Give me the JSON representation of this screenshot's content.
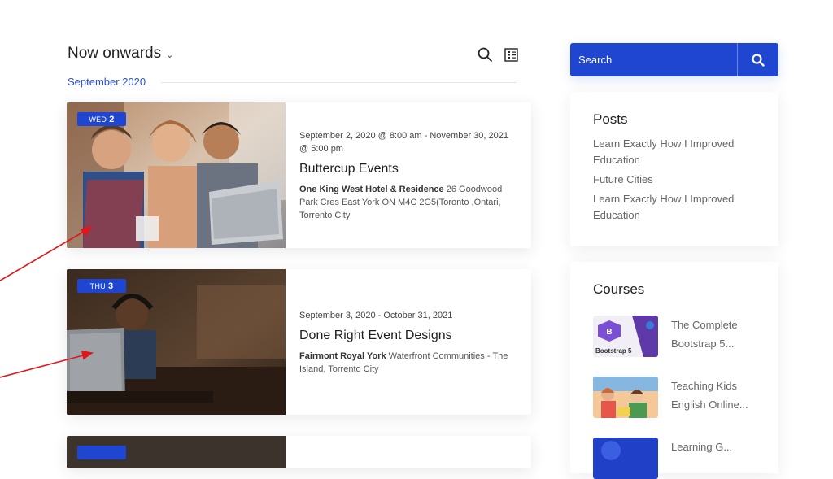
{
  "header": {
    "filter_label": "Now onwards",
    "month_label": "September 2020"
  },
  "events": [
    {
      "badge_day": "WED",
      "badge_num": "2",
      "date_range": "September 2, 2020 @ 8:00 am - November 30, 2021 @ 5:00 pm",
      "title": "Buttercup Events",
      "venue_name": "One King West Hotel & Residence",
      "venue_address": " 26 Goodwood Park Cres East York ON M4C 2G5(Toronto ,Ontari, Torrento City"
    },
    {
      "badge_day": "THU",
      "badge_num": "3",
      "date_range": "September 3, 2020 - October 31, 2021",
      "title": "Done Right Event Designs",
      "venue_name": "Fairmont Royal York",
      "venue_address": " Waterfront Communities - The Island, Torrento City"
    }
  ],
  "sidebar": {
    "search_placeholder": "Search",
    "posts_title": "Posts",
    "posts": [
      "Learn Exactly How I Improved Education",
      "Future Cities",
      "Learn Exactly How I Improved Education"
    ],
    "courses_title": "Courses",
    "courses": [
      {
        "name": "The Complete Bootstrap 5...",
        "thumb_label": "Bootstrap 5"
      },
      {
        "name": "Teaching Kids English Online..."
      },
      {
        "name": "Learning G..."
      }
    ]
  },
  "icons": {
    "search": "search-icon",
    "list_view": "list-view-icon",
    "chevron": "chevron-down-icon"
  },
  "colors": {
    "accent": "#1f46d1",
    "annotation": "#e0161b"
  }
}
